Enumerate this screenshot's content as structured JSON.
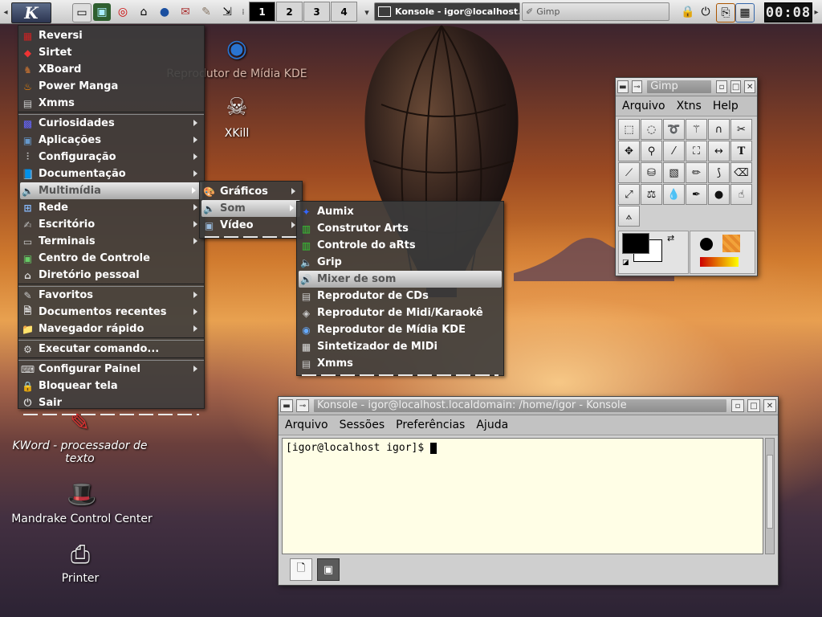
{
  "panel": {
    "pager": [
      "1",
      "2",
      "3",
      "4"
    ],
    "active_desktop": "1",
    "tasks": [
      {
        "label": "Konsole - igor@localhost.loc",
        "active": true
      },
      {
        "label": "Gimp",
        "active": false
      }
    ],
    "clock": "00:08",
    "quick_icons": [
      "show-desktop-icon",
      "terminal-icon",
      "help-lifebuoy-icon",
      "home-icon",
      "globe-icon",
      "mail-icon",
      "edit-icon",
      "window-list-icon"
    ],
    "tray_icons": [
      "lock-icon",
      "power-icon",
      "clipboard-icon",
      "calendar-icon"
    ]
  },
  "desktop_icons": [
    {
      "label": "Reprodutor de Mídia KDE",
      "icon": "media-player-icon"
    },
    {
      "label": "XKill",
      "icon": "skull-icon"
    },
    {
      "label": "KWord - processador de texto",
      "icon": "kword-icon"
    },
    {
      "label": "Mandrake Control Center",
      "icon": "control-center-hat-icon"
    },
    {
      "label": "Printer",
      "icon": "printer-icon"
    }
  ],
  "kmenu": {
    "group1": [
      "Reversi",
      "Sirtet",
      "XBoard",
      "Power Manga",
      "Xmms"
    ],
    "group2": [
      "Curiosidades",
      "Aplicações",
      "Configuração",
      "Documentação",
      "Multimídia",
      "Rede",
      "Escritório",
      "Terminais",
      "Centro de Controle",
      "Diretório pessoal"
    ],
    "group3": [
      "Favoritos",
      "Documentos recentes",
      "Navegador rápido"
    ],
    "group4": [
      "Executar comando..."
    ],
    "group5": [
      "Configurar Painel",
      "Bloquear tela",
      "Sair"
    ]
  },
  "multimidia_menu": [
    "Gráficos",
    "Som",
    "Vídeo"
  ],
  "som_menu": [
    "Aumix",
    "Construtor Arts",
    "Controle do aRts",
    "Grip",
    "Mixer de som",
    "Reprodutor de CDs",
    "Reprodutor de Midi/Karaokê",
    "Reprodutor de Mídia KDE",
    "Sintetizador de MIDi",
    "Xmms"
  ],
  "gimp": {
    "title": "Gimp",
    "menu": [
      "Arquivo",
      "Xtns",
      "Help"
    ]
  },
  "konsole": {
    "title": "Konsole - igor@localhost.localdomain: /home/igor - Konsole",
    "menu": [
      "Arquivo",
      "Sessões",
      "Preferências",
      "Ajuda"
    ],
    "prompt": "[igor@localhost igor]$"
  },
  "colors": {
    "menu_bg": "#3c3c3c",
    "highlight": "#d0d0d0",
    "terminal_bg": "#fffee6"
  }
}
